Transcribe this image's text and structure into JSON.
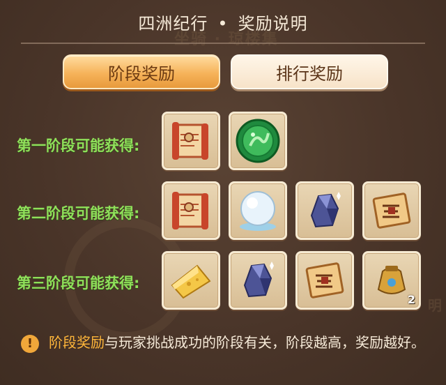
{
  "header": {
    "title_left": "四洲纪行",
    "title_separator": "•",
    "title_right": "奖励说明",
    "ghost_text": "坐骑 · 琼楼集"
  },
  "tabs": [
    {
      "label": "阶段奖励",
      "active": true
    },
    {
      "label": "排行奖励",
      "active": false
    }
  ],
  "stages": [
    {
      "label": "第一阶段可能获得:",
      "rewards": [
        {
          "icon": "scroll-icon"
        },
        {
          "icon": "jade-medallion-icon"
        }
      ]
    },
    {
      "label": "第二阶段可能获得:",
      "rewards": [
        {
          "icon": "scroll-icon"
        },
        {
          "icon": "pearl-orb-icon"
        },
        {
          "icon": "crystal-ore-icon"
        },
        {
          "icon": "map-scroll-icon"
        }
      ]
    },
    {
      "label": "第三阶段可能获得:",
      "rewards": [
        {
          "icon": "gold-ingot-icon"
        },
        {
          "icon": "crystal-ore-icon"
        },
        {
          "icon": "map-scroll-icon"
        },
        {
          "icon": "golden-pot-icon",
          "count": "2"
        }
      ]
    }
  ],
  "note": {
    "highlight": "阶段奖励",
    "text": "与玩家挑战成功的阶段有关，阶段越高，奖励越好。",
    "icon": "exclamation-icon",
    "icon_symbol": "!"
  },
  "colors": {
    "highlight": "#ffb63a",
    "stage_label": "#8fe05a",
    "tab_active": "#f6b35a"
  }
}
